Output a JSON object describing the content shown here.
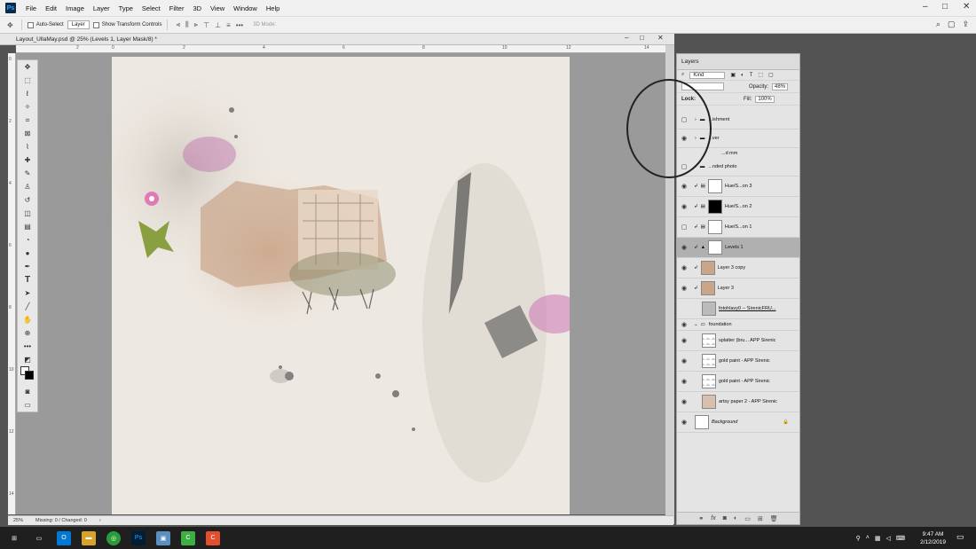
{
  "menubar": {
    "logo": "Ps",
    "items": [
      "File",
      "Edit",
      "Image",
      "Layer",
      "Type",
      "Select",
      "Filter",
      "3D",
      "View",
      "Window",
      "Help"
    ]
  },
  "options": {
    "auto_select": "Auto-Select",
    "layer_dd": "Layer",
    "show_transform": "Show Transform Controls",
    "mode_3d": "3D Mode:"
  },
  "document": {
    "tab_title": "Layout_UllaMay.psd @ 25% (Levels 1, Layer Mask/8) *",
    "zoom": "25%",
    "status": "Missing: 0 / Changed: 0"
  },
  "ruler": {
    "top": [
      "2",
      "0",
      "2",
      "4",
      "6",
      "8",
      "10",
      "12",
      "14"
    ],
    "left": [
      "0",
      "2",
      "4",
      "6",
      "8",
      "10",
      "12",
      "14"
    ]
  },
  "layers_panel": {
    "title": "Layers",
    "kind": "Kind",
    "lock": "Lock:",
    "opacity_label": "Opacity:",
    "opacity": "48%",
    "fill_label": "Fill:",
    "fill": "100%",
    "layers": [
      {
        "name": "...ishment",
        "type": "group"
      },
      {
        "name": "...ver",
        "type": "group"
      },
      {
        "name": "...d mm",
        "type": "text"
      },
      {
        "name": "...nded photo",
        "type": "group"
      },
      {
        "name": "Hue/S...on 3",
        "type": "adj"
      },
      {
        "name": "Hue/S...on 2",
        "type": "adj"
      },
      {
        "name": "Hue/S...on 1",
        "type": "adj"
      },
      {
        "name": "Levels 1",
        "type": "adj"
      },
      {
        "name": "Layer 3 copy",
        "type": "photo"
      },
      {
        "name": "Layer 3",
        "type": "photo"
      },
      {
        "name": "fotohlavy0 -- SirenicFRU...",
        "type": "photo"
      },
      {
        "name": "foundation",
        "type": "group"
      },
      {
        "name": "splatter (bru... APP Sirenic",
        "type": "layer"
      },
      {
        "name": "gold paint - APP Sirenic",
        "type": "layer"
      },
      {
        "name": "gold paint - APP Sirenic",
        "type": "layer"
      },
      {
        "name": "artsy paper 2 - APP Sirenic",
        "type": "layer"
      },
      {
        "name": "Background",
        "type": "bg"
      }
    ]
  },
  "taskbar": {
    "time": "9:47 AM",
    "date": "2/12/2019"
  },
  "icons": {
    "move": "✥",
    "marquee": "⬚",
    "lasso": "ʘ",
    "brush": "✎",
    "crop": "⌗",
    "eye": "👁",
    "search": "⌕",
    "hand": "✋",
    "zoom": "⊕"
  }
}
